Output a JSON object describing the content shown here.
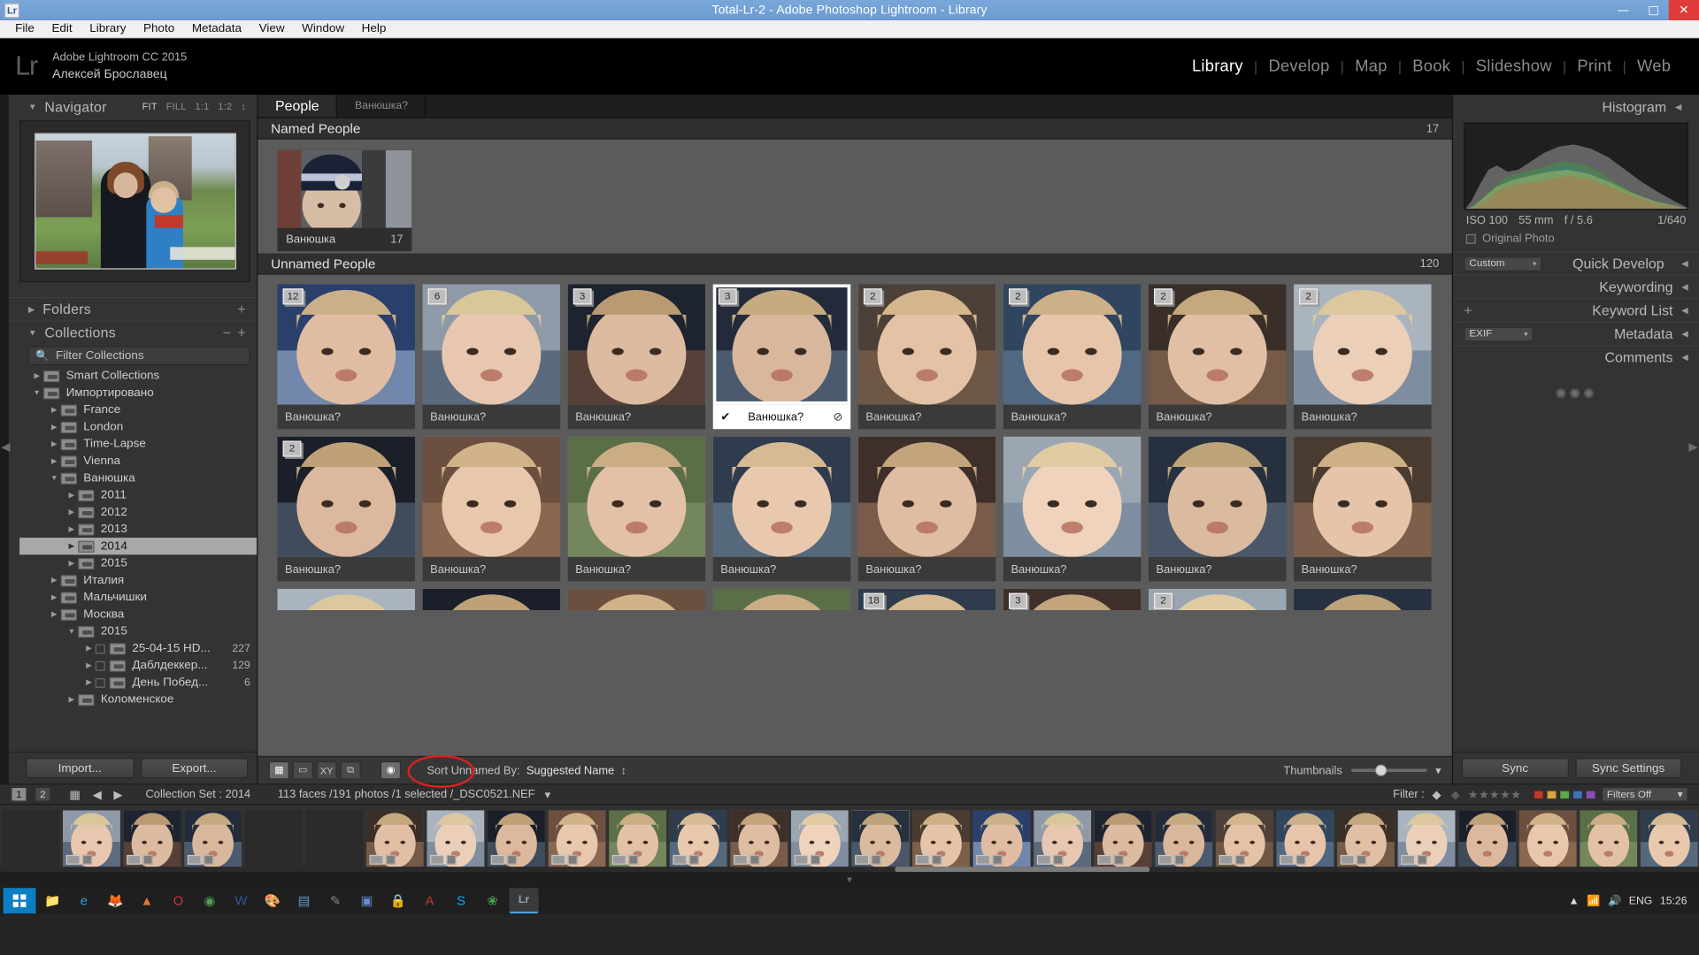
{
  "window": {
    "title": "Total-Lr-2 - Adobe Photoshop Lightroom - Library",
    "app_icon": "Lr",
    "minimize": "—",
    "maximize": "□",
    "close": "✕"
  },
  "menubar": [
    "File",
    "Edit",
    "Library",
    "Photo",
    "Metadata",
    "View",
    "Window",
    "Help"
  ],
  "identity": {
    "logo": "Lr",
    "product": "Adobe Lightroom CC 2015",
    "user": "Алексей Брославец"
  },
  "modules": [
    "Library",
    "Develop",
    "Map",
    "Book",
    "Slideshow",
    "Print",
    "Web"
  ],
  "active_module": "Library",
  "left_panel": {
    "navigator": {
      "title": "Navigator",
      "options": [
        "FIT",
        "FILL",
        "1:1",
        "1:2"
      ],
      "selected_option": "FIT"
    },
    "folders": {
      "title": "Folders"
    },
    "collections": {
      "title": "Collections",
      "filter_placeholder": "Filter Collections",
      "minus": "−",
      "plus": "+",
      "items": [
        {
          "label": "Smart Collections",
          "depth": 0,
          "twisty": "▶",
          "selected": false,
          "count": ""
        },
        {
          "label": "Импортировано",
          "depth": 0,
          "twisty": "▼",
          "selected": false,
          "count": ""
        },
        {
          "label": "France",
          "depth": 1,
          "twisty": "▶",
          "selected": false,
          "count": ""
        },
        {
          "label": "London",
          "depth": 1,
          "twisty": "▶",
          "selected": false,
          "count": ""
        },
        {
          "label": "Time-Lapse",
          "depth": 1,
          "twisty": "▶",
          "selected": false,
          "count": ""
        },
        {
          "label": "Vienna",
          "depth": 1,
          "twisty": "▶",
          "selected": false,
          "count": ""
        },
        {
          "label": "Ванюшка",
          "depth": 1,
          "twisty": "▼",
          "selected": false,
          "count": ""
        },
        {
          "label": "2011",
          "depth": 2,
          "twisty": "▶",
          "selected": false,
          "count": ""
        },
        {
          "label": "2012",
          "depth": 2,
          "twisty": "▶",
          "selected": false,
          "count": ""
        },
        {
          "label": "2013",
          "depth": 2,
          "twisty": "▶",
          "selected": false,
          "count": ""
        },
        {
          "label": "2014",
          "depth": 2,
          "twisty": "▶",
          "selected": true,
          "count": ""
        },
        {
          "label": "2015",
          "depth": 2,
          "twisty": "▶",
          "selected": false,
          "count": ""
        },
        {
          "label": "Италия",
          "depth": 1,
          "twisty": "▶",
          "selected": false,
          "count": ""
        },
        {
          "label": "Мальчишки",
          "depth": 1,
          "twisty": "▶",
          "selected": false,
          "count": ""
        },
        {
          "label": "Москва",
          "depth": 1,
          "twisty": "▶",
          "selected": false,
          "count": ""
        },
        {
          "label": "2015",
          "depth": 2,
          "twisty": "▼",
          "selected": false,
          "count": ""
        },
        {
          "label": "25-04-15 HD...",
          "depth": 3,
          "twisty": "▶",
          "selected": false,
          "count": "227"
        },
        {
          "label": "Даблдеккер...",
          "depth": 3,
          "twisty": "▶",
          "selected": false,
          "count": "129"
        },
        {
          "label": "День Побед...",
          "depth": 3,
          "twisty": "▶",
          "selected": false,
          "count": "6"
        },
        {
          "label": "Коломенское",
          "depth": 2,
          "twisty": "▶",
          "selected": false,
          "count": ""
        }
      ]
    },
    "buttons": {
      "import": "Import...",
      "export": "Export..."
    }
  },
  "center": {
    "tabs": [
      {
        "label": "People",
        "active": true
      },
      {
        "label": "Ванюшка?",
        "active": false
      }
    ],
    "named_section": {
      "title": "Named People",
      "count": "17"
    },
    "named_people": [
      {
        "name": "Ванюшка",
        "count": "17"
      }
    ],
    "unnamed_section": {
      "title": "Unnamed People",
      "count": "120"
    },
    "unnamed_people": [
      {
        "label": "Ванюшка?",
        "badge": "12",
        "selected": false
      },
      {
        "label": "Ванюшка?",
        "badge": "6",
        "selected": false
      },
      {
        "label": "Ванюшка?",
        "badge": "3",
        "selected": false
      },
      {
        "label": "Ванюшка?",
        "badge": "3",
        "selected": true
      },
      {
        "label": "Ванюшка?",
        "badge": "2",
        "selected": false
      },
      {
        "label": "Ванюшка?",
        "badge": "2",
        "selected": false
      },
      {
        "label": "Ванюшка?",
        "badge": "2",
        "selected": false
      },
      {
        "label": "Ванюшка?",
        "badge": "2",
        "selected": false
      },
      {
        "label": "Ванюшка?",
        "badge": "2",
        "selected": false
      },
      {
        "label": "Ванюшка?",
        "badge": "",
        "selected": false
      },
      {
        "label": "Ванюшка?",
        "badge": "",
        "selected": false
      },
      {
        "label": "Ванюшка?",
        "badge": "",
        "selected": false
      },
      {
        "label": "Ванюшка?",
        "badge": "",
        "selected": false
      },
      {
        "label": "Ванюшка?",
        "badge": "",
        "selected": false
      },
      {
        "label": "Ванюшка?",
        "badge": "",
        "selected": false
      },
      {
        "label": "Ванюшка?",
        "badge": "",
        "selected": false
      }
    ],
    "partial_row": [
      {
        "badge": ""
      },
      {
        "badge": ""
      },
      {
        "badge": ""
      },
      {
        "badge": ""
      },
      {
        "badge": "18"
      },
      {
        "badge": "3"
      },
      {
        "badge": "2"
      },
      {
        "badge": ""
      }
    ],
    "selected_cell": {
      "check": "✔",
      "reject": "⊘"
    },
    "toolbar": {
      "grid_icon": "▦",
      "loupe_icon": "▭",
      "compare_icon": "XY",
      "survey_icon": "⧉",
      "people_icon": "◉",
      "sort_label": "Sort Unnamed By:",
      "sort_value": "Suggested Name",
      "sort_arrows": "↕",
      "thumbnails_label": "Thumbnails",
      "dropdown_arrow": "▾"
    }
  },
  "right_panel": {
    "histogram": {
      "title": "Histogram"
    },
    "exif": {
      "iso": "ISO 100",
      "focal": "55 mm",
      "aperture": "f / 5.6",
      "shutter": "1/640"
    },
    "original_photo": "Original Photo",
    "quick_develop": {
      "title": "Quick Develop",
      "preset": "Custom"
    },
    "keywording": {
      "title": "Keywording"
    },
    "keyword_list": {
      "title": "Keyword List",
      "plus": "+"
    },
    "metadata": {
      "title": "Metadata",
      "preset": "EXIF"
    },
    "comments": {
      "title": "Comments"
    },
    "buttons": {
      "sync": "Sync",
      "sync_settings": "Sync Settings"
    }
  },
  "filter_bar": {
    "page_prev": "1",
    "page_next": "2",
    "grid_icon": "▦",
    "back_arrow": "◀",
    "fwd_arrow": "▶",
    "collection_label": "Collection Set : 2014",
    "status": "113 faces /191 photos /1 selected /_DSC0521.NEF",
    "status_arrow": "▾",
    "filter_label": "Filter :",
    "flag_icon": "◆",
    "star_icon": "★",
    "stars": 5,
    "color_swatches": [
      "#c0392b",
      "#d9a441",
      "#5fa84b",
      "#3a74b8",
      "#8a4fb0"
    ],
    "filters_off": "Filters Off",
    "filters_arrow": "▾"
  },
  "taskbar": {
    "icons": [
      "folder",
      "edge",
      "firefox",
      "vlc",
      "opera",
      "chrome",
      "word",
      "palette",
      "calc",
      "editor",
      "photo",
      "lock",
      "acrobat",
      "skype",
      "garden",
      "lightroom"
    ],
    "language": "ENG",
    "time": "15:26",
    "tray_arrow": "▲"
  }
}
